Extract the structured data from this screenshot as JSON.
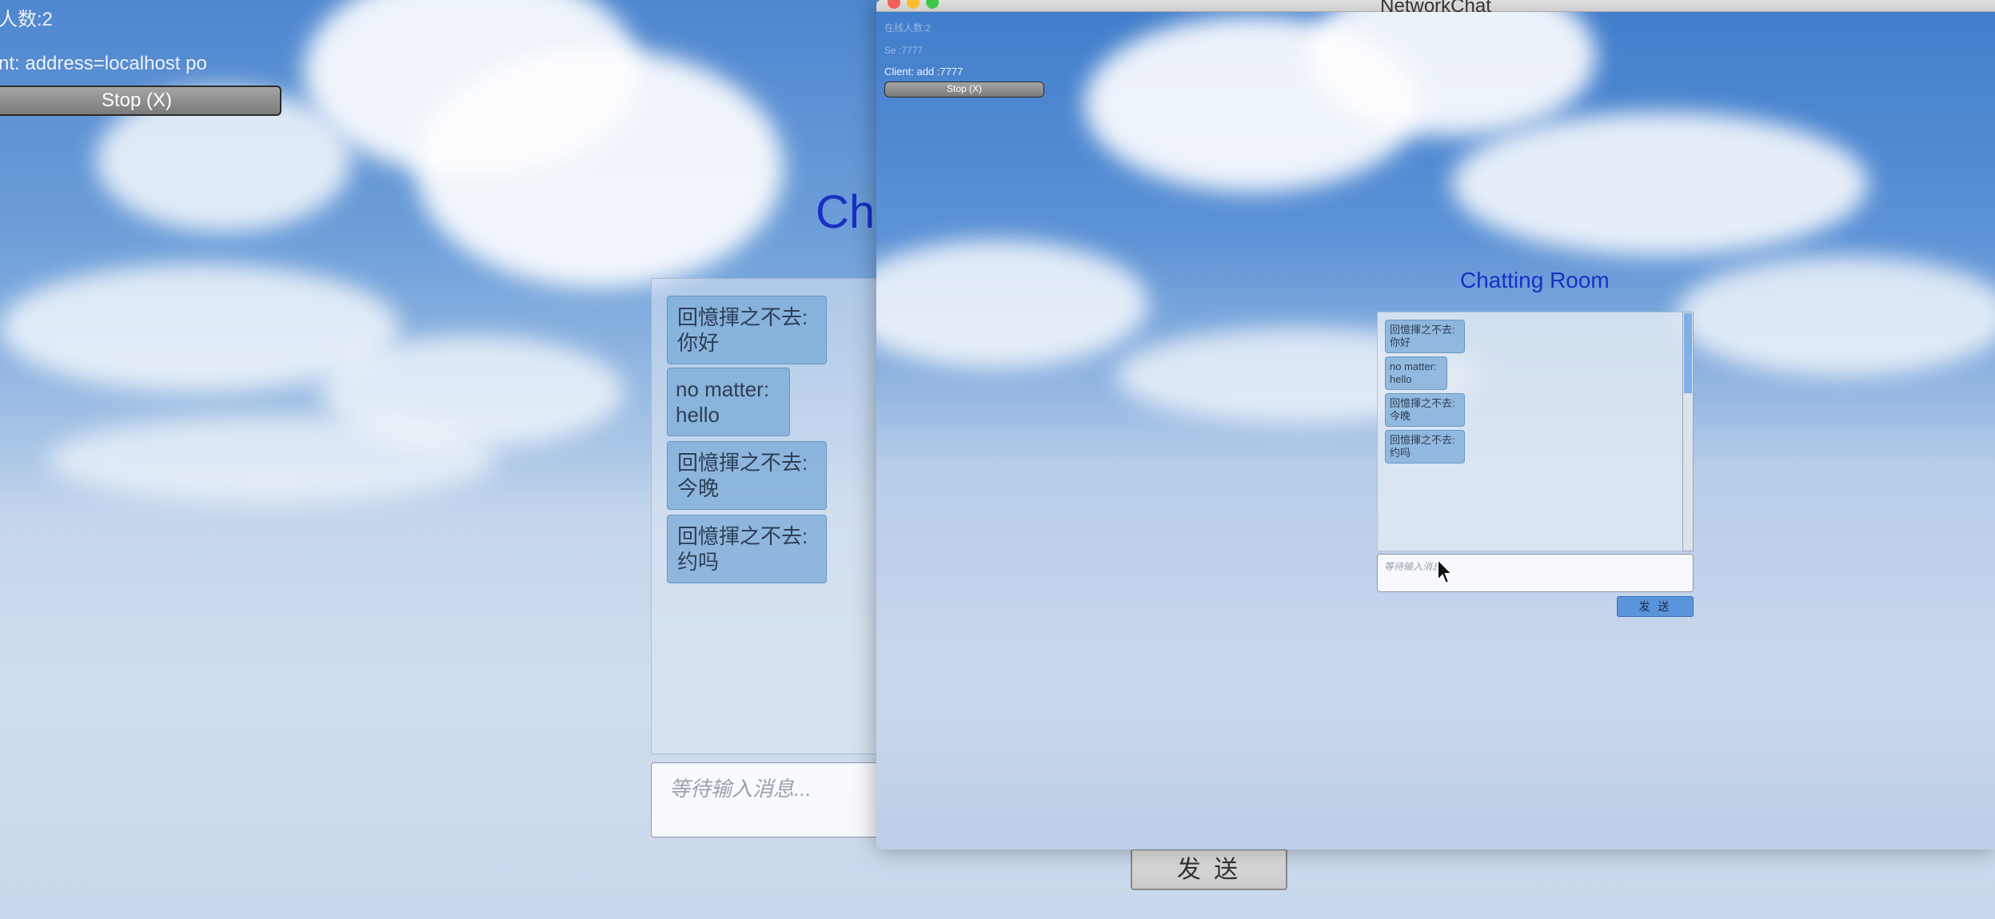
{
  "back_window": {
    "online_count": "人数:2",
    "client_info": "nt: address=localhost po",
    "stop_button": "Stop (X)",
    "room_title_partial": "Ch",
    "messages": [
      {
        "line1": "回憶揮之不去:",
        "line2": "你好"
      },
      {
        "line1": "no matter:",
        "line2": "hello"
      },
      {
        "line1": "回憶揮之不去:",
        "line2": "今晚"
      },
      {
        "line1": "回憶揮之不去:",
        "line2": "约吗"
      }
    ],
    "input_placeholder": "等待输入消息...",
    "send_button": "发 送"
  },
  "front_window": {
    "title": "NetworkChat",
    "hud": {
      "line1": "在线人数:2",
      "line2": "Se  :7777",
      "line3": "Client: add   :7777",
      "stop_button": "Stop (X)"
    },
    "room_title": "Chatting Room",
    "messages": [
      {
        "line1": "回憶揮之不去:",
        "line2": "你好"
      },
      {
        "line1": "no matter:",
        "line2": "hello"
      },
      {
        "line1": "回憶揮之不去:",
        "line2": "今晚"
      },
      {
        "line1": "回憶揮之不去:",
        "line2": "约吗"
      }
    ],
    "input_placeholder": "等待输入消息...",
    "send_button": "发 送"
  },
  "colors": {
    "title_blue": "#1a2fc4",
    "send_blue": "#5a95dc",
    "scrollbar_blue": "#7fb0e6"
  }
}
